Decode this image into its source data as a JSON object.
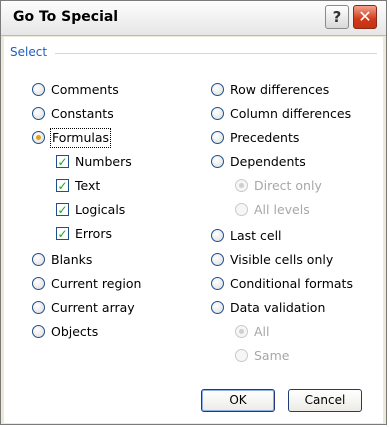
{
  "window": {
    "title": "Go To Special"
  },
  "titlebar": {
    "help_glyph": "?",
    "close_glyph": "✕"
  },
  "group": {
    "label": "Select"
  },
  "left_options": [
    {
      "label": "Comments",
      "checked": false
    },
    {
      "label": "Constants",
      "checked": false
    },
    {
      "label": "Formulas",
      "checked": true
    },
    {
      "label": "Blanks",
      "checked": false
    },
    {
      "label": "Current region",
      "checked": false
    },
    {
      "label": "Current array",
      "checked": false
    },
    {
      "label": "Objects",
      "checked": false
    }
  ],
  "formula_types": [
    {
      "label": "Numbers",
      "checked": true
    },
    {
      "label": "Text",
      "checked": true
    },
    {
      "label": "Logicals",
      "checked": true
    },
    {
      "label": "Errors",
      "checked": true
    }
  ],
  "right_options": [
    {
      "label": "Row differences",
      "checked": false
    },
    {
      "label": "Column differences",
      "checked": false
    },
    {
      "label": "Precedents",
      "checked": false
    },
    {
      "label": "Dependents",
      "checked": false
    },
    {
      "label": "Last cell",
      "checked": false
    },
    {
      "label": "Visible cells only",
      "checked": false
    },
    {
      "label": "Conditional formats",
      "checked": false
    },
    {
      "label": "Data validation",
      "checked": false
    }
  ],
  "dependents_scope": [
    {
      "label": "Direct only",
      "checked": true,
      "enabled": false
    },
    {
      "label": "All levels",
      "checked": false,
      "enabled": false
    }
  ],
  "validation_scope": [
    {
      "label": "All",
      "checked": true,
      "enabled": false
    },
    {
      "label": "Same",
      "checked": false,
      "enabled": false
    }
  ],
  "buttons": {
    "ok": "OK",
    "cancel": "Cancel"
  }
}
